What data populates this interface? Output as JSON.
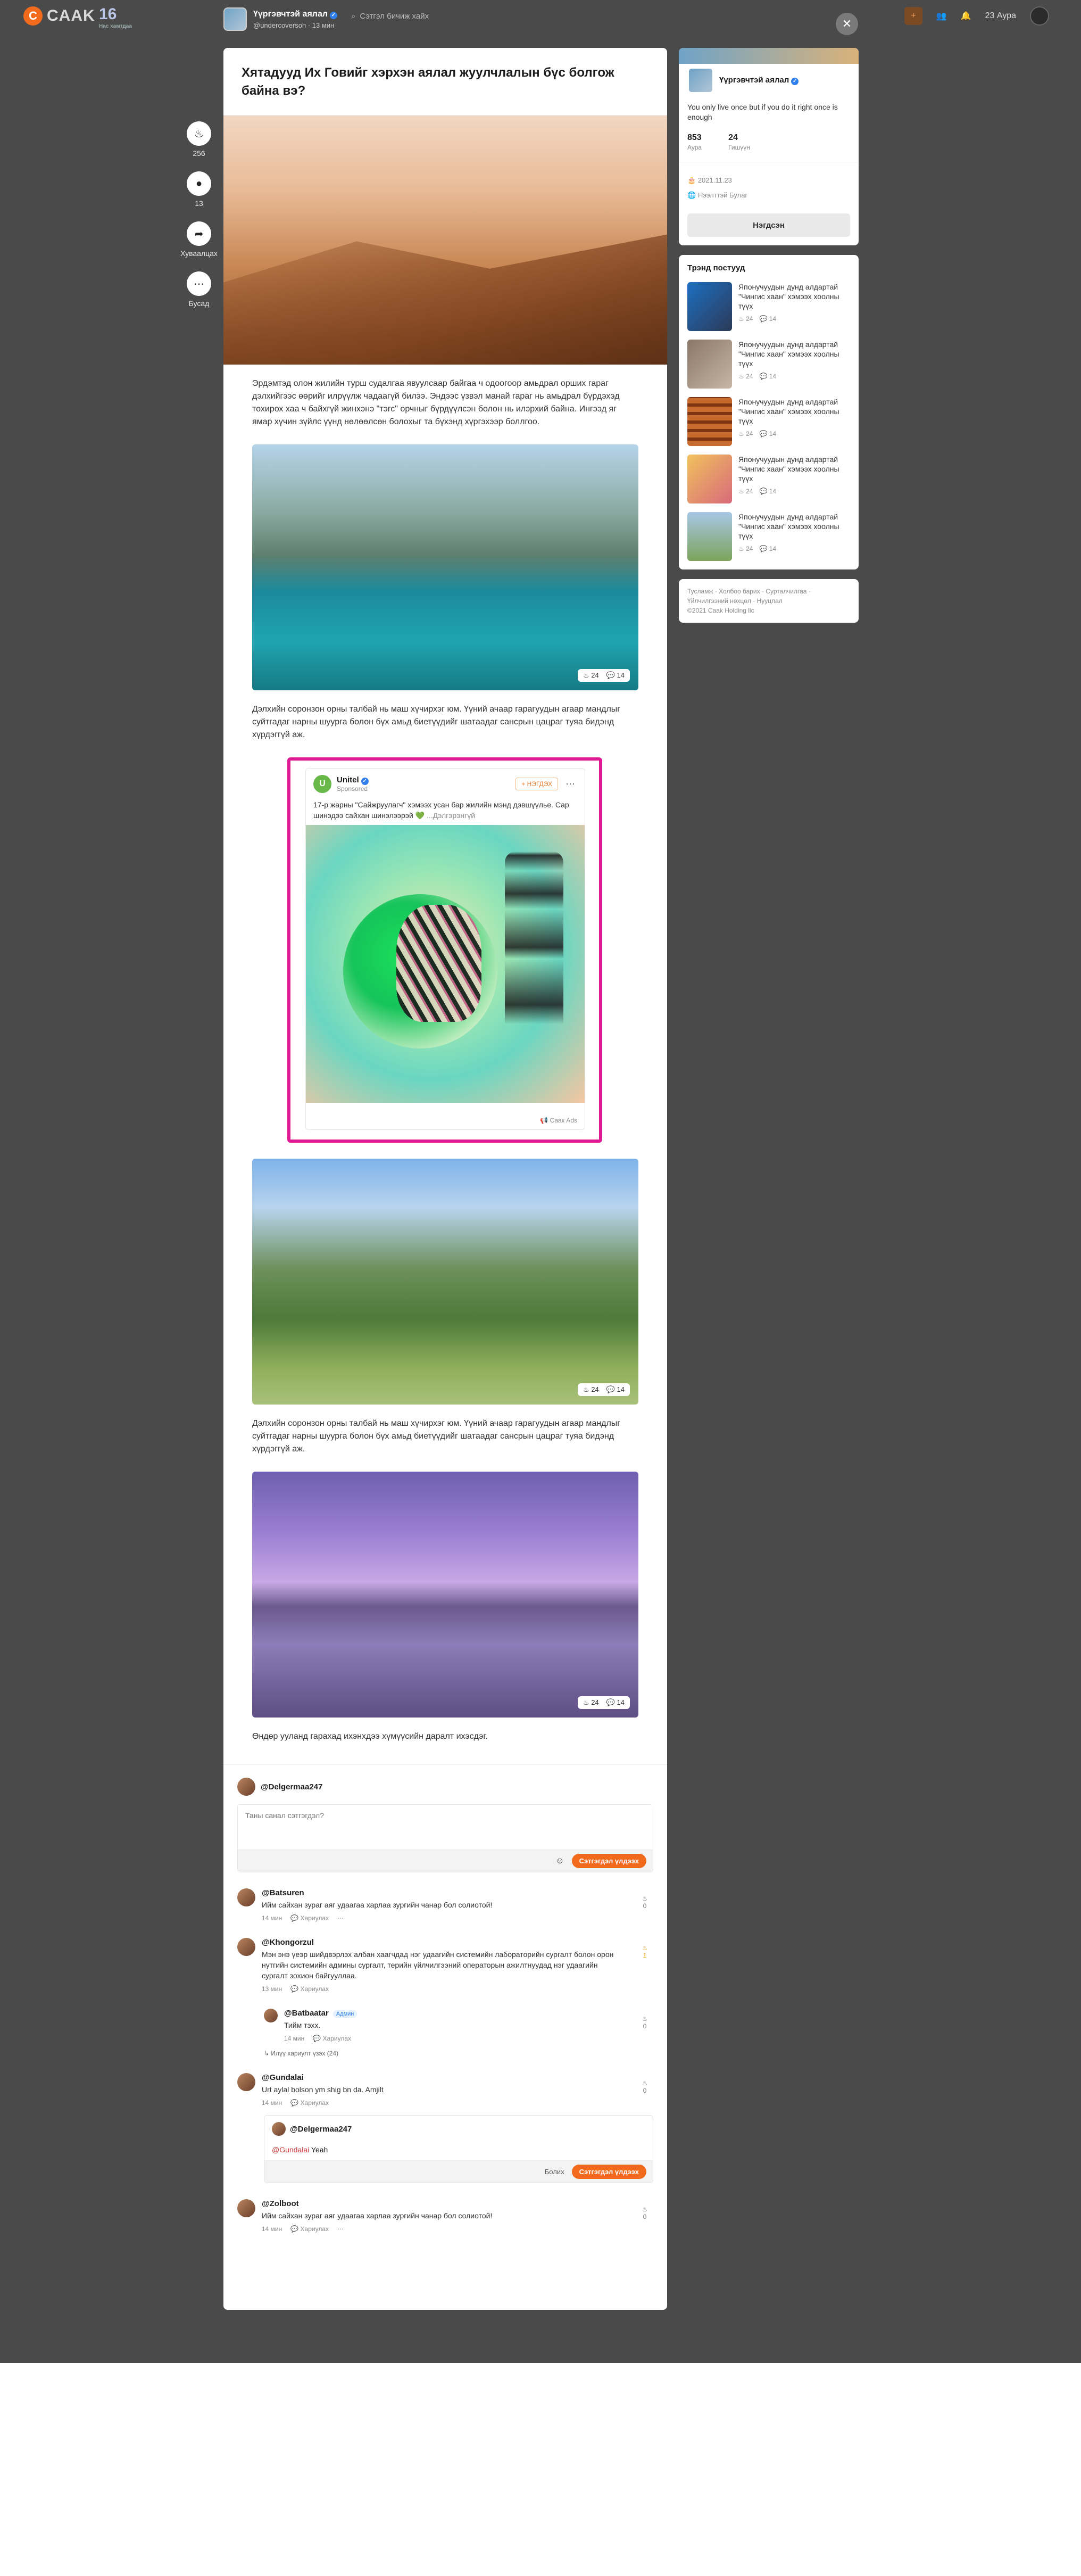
{
  "topbar": {
    "logo_text": "CAAK",
    "anniv_num": "16",
    "anniv_text": "Нас хамтдаа",
    "search_placeholder": "Сэтгэл бичиж хайх",
    "aura": "23 Аура"
  },
  "post_header": {
    "channel": "Үүргэвчтэй аялал",
    "username": "@undercoversoh",
    "time": "13 мин"
  },
  "rail": {
    "like_count": "256",
    "comment_count": "13",
    "share_label": "Хуваалцах",
    "more_label": "Бусад"
  },
  "article": {
    "title": "Хятадууд Их Говийг хэрхэн аялал жуулчлалын бүс болгож байна вэ?",
    "para1": "Эрдэмтэд олон жилийн турш судалгаа явуулсаар байгаа ч одоогоор амьдрал орших гараг дэлхийгээс өөрийг илрүүлж чадаагүй билээ. Эндээс үзвэл манай гараг нь амьдрал бүрдэхэд тохирох хаа ч байхгүй жинхэнэ \"тэгс\" орчныг бүрдүүлсэн болон нь илэрхий байна. Ингээд яг ямар хүчин зүйлс үүнд нөлөөлсөн болохыг та бүхэнд хүргэхээр боллгоо.",
    "para2": "Дэлхийн соронзон орны талбай нь маш хүчирхэг юм. Үүний ачаар гарагуудын агаар мандлыг суйтгадаг нарны шуурга болон бүх амьд биетүүдийг шатаадаг сансрын цацраг туяа бидэнд хүрдэггүй аж.",
    "para3": "Дэлхийн соронзон орны талбай нь маш хүчирхэг юм. Үүний ачаар гарагуудын агаар мандлыг суйтгадаг нарны шуурга болон бүх амьд биетүүдийг шатаадаг сансрын цацраг туяа бидэнд хүрдэггүй аж.",
    "para4": "Өндөр ууланд гарахад ихэнхдээ хүмүүсийн даралт ихэсдэг.",
    "img_likes": "24",
    "img_comments": "14"
  },
  "ad": {
    "brand": "Unitel",
    "sponsored": "Sponsored",
    "follow": "НЭГДЭХ",
    "text": "17-р жарны \"Сайжруулагч\" хэмээх усан бар жилийн мэнд дэвшүүлье. Сар шинэдээ сайхан шинэлээрэй 💚",
    "more": "...Дэлгэрэнгүй",
    "footer": "Саак Ads"
  },
  "comments": {
    "current_user": "@Delgermaa247",
    "placeholder": "Таны санал сэтгэгдэл?",
    "submit": "Сэтгэгдэл үлдээх",
    "cancel": "Болих",
    "more_replies": "Илүү хариулт үзэх (24)",
    "reply_label": "Хариулах",
    "items": [
      {
        "name": "@Batsuren",
        "text": "Ийм сайхан зураг аяг удаагаа харлаа зургийн чанар бол солиотой!",
        "time": "14 мин",
        "likes": "0"
      },
      {
        "name": "@Khongorzul",
        "text": "Мэн энэ үеэр шийдвэрлэх албан хаагчдад нэг удаагийн системийн лабораторийн сургалт болон орон нутгийн системийн админы сургалт, терийн үйлчилгээний операторын ажилтнуудад нэг удаагийн сургалт зохион байгууллаа.",
        "time": "13 мин",
        "likes": "1"
      },
      {
        "name": "@Batbaatar",
        "admin": "Админ",
        "text": "Тийм тэхх.",
        "time": "14 мин",
        "likes": "0"
      },
      {
        "name": "@Gundalai",
        "text": "Urt aylal bolson ym shig bn da. Amjilt",
        "time": "14 мин",
        "likes": "0"
      },
      {
        "name": "@Zolboot",
        "text": "Ийм сайхан зураг аяг удаагаа харлаа зургийн чанар бол солиотой!",
        "time": "14 мин",
        "likes": "0"
      }
    ],
    "reply_user": "@Delgermaa247",
    "reply_mention": "@Gundalai",
    "reply_typed": "Yeah"
  },
  "sidebar": {
    "profile": {
      "name": "Үүргэвчтэй аялал",
      "bio": "You only live once but if you do it right once is enough",
      "aura_num": "853",
      "aura_lbl": "Аура",
      "follow_num": "24",
      "follow_lbl": "Гишүүн",
      "date": "2021.11.23",
      "location": "Нээлттэй Булаг",
      "button": "Нэгдсэн"
    },
    "trend_title": "Трэнд постууд",
    "trend_text": "Японучуудын дунд алдартай \"Чингис хаан\" хэмээх хоолны түүх",
    "trend_likes": "24",
    "trend_comments": "14",
    "footer_links": "Тусламж · Холбоо барих · Сурталчилгаа · Үйлчилгээний нөхцөл · Нууцлал",
    "copyright": "©2021 Caak Holding llc"
  }
}
